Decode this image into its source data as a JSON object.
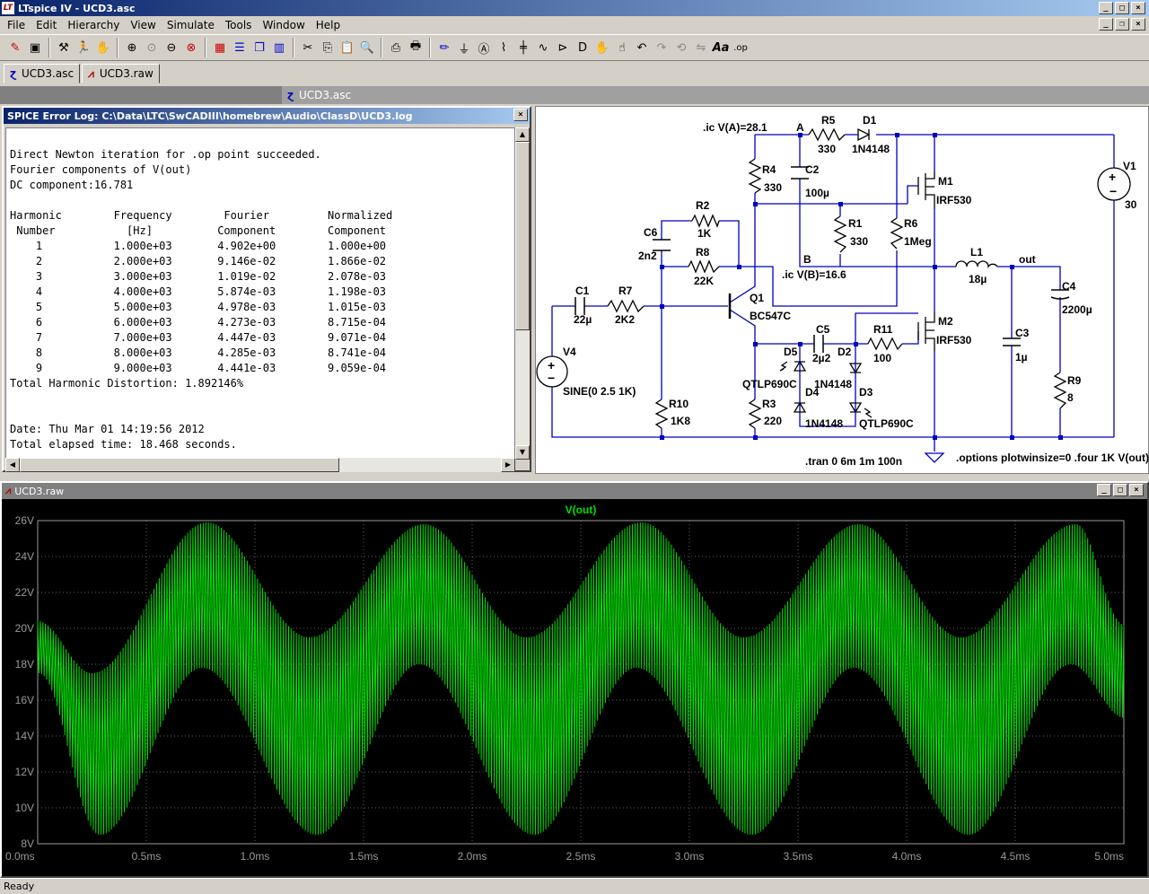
{
  "window": {
    "title": "LTspice IV - UCD3.asc",
    "controls": [
      "_",
      "□",
      "×"
    ]
  },
  "menu": [
    "File",
    "Edit",
    "Hierarchy",
    "View",
    "Simulate",
    "Tools",
    "Window",
    "Help"
  ],
  "mdi_controls": [
    "_",
    "❐",
    "×"
  ],
  "toolbar_icons": [
    "new-schematic-icon",
    "save-icon",
    "hammer-icon",
    "run-icon",
    "halt-icon",
    "zoom-in-icon",
    "zoom-pan-icon",
    "zoom-out-icon",
    "zoom-cancel-icon",
    "autorange-icon",
    "tile-horizontal-icon",
    "cascade-icon",
    "tile-vertical-icon",
    "cut-icon",
    "copy-icon",
    "paste-icon",
    "find-icon",
    "print-setup-icon",
    "print-icon",
    "draw-wire-icon",
    "ground-icon",
    "label-icon",
    "resistor-icon",
    "capacitor-icon",
    "inductor-icon",
    "diode-icon",
    "component-icon",
    "move-icon",
    "drag-icon",
    "undo-icon",
    "redo-icon",
    "rotate-icon",
    "mirror-icon",
    "text-icon",
    "spice-directive-icon"
  ],
  "tabs": [
    {
      "label": "UCD3.asc",
      "icon": "schematic-icon"
    },
    {
      "label": "UCD3.raw",
      "icon": "waveform-icon"
    }
  ],
  "mdi_active_title": "UCD3.asc",
  "error_log": {
    "title": "SPICE Error Log: C:\\Data\\LTC\\SwCADIII\\homebrew\\Audio\\ClassD\\UCD3.log",
    "close": "×",
    "text": "\nDirect Newton iteration for .op point succeeded.\nFourier components of V(out)\nDC component:16.781\n\nHarmonic        Frequency        Fourier         Normalized\n Number           [Hz]          Component        Component\n    1           1.000e+03       4.902e+00        1.000e+00\n    2           2.000e+03       9.146e-02        1.866e-02\n    3           3.000e+03       1.019e-02        2.078e-03\n    4           4.000e+03       5.874e-03        1.198e-03\n    5           5.000e+03       4.978e-03        1.015e-03\n    6           6.000e+03       4.273e-03        8.715e-04\n    7           7.000e+03       4.447e-03        9.071e-04\n    8           8.000e+03       4.285e-03        8.741e-04\n    9           9.000e+03       4.441e-03        9.059e-04\nTotal Harmonic Distortion: 1.892146%\n\n\nDate: Thu Mar 01 14:19:56 2012\nTotal elapsed time: 18.468 seconds."
  },
  "schematic": {
    "ic_a": ".ic V(A)=28.1",
    "ic_b": ".ic V(B)=16.6",
    "tran": ".tran 0 6m 1m 100n",
    "options": ".options plotwinsize=0 .four 1K V(out)",
    "node_a": "A",
    "node_b": "B",
    "node_out": "out",
    "components": {
      "R5": {
        "name": "R5",
        "value": "330"
      },
      "D1": {
        "name": "D1",
        "value": "1N4148"
      },
      "V1": {
        "name": "V1",
        "value": "30"
      },
      "R4": {
        "name": "R4",
        "value": "330"
      },
      "C2": {
        "name": "C2",
        "value": "100µ"
      },
      "M1": {
        "name": "M1",
        "value": "IRF530"
      },
      "R2": {
        "name": "R2",
        "value": "1K"
      },
      "R1": {
        "name": "R1",
        "value": "330"
      },
      "R6": {
        "name": "R6",
        "value": "1Meg"
      },
      "C6": {
        "name": "C6",
        "value": "2n2"
      },
      "R8": {
        "name": "R8",
        "value": "22K"
      },
      "L1": {
        "name": "L1",
        "value": "18µ"
      },
      "C4": {
        "name": "C4",
        "value": "2200µ"
      },
      "C1": {
        "name": "C1",
        "value": "22µ"
      },
      "R7": {
        "name": "R7",
        "value": "2K2"
      },
      "Q1": {
        "name": "Q1",
        "value": "BC547C"
      },
      "M2": {
        "name": "M2",
        "value": "IRF530"
      },
      "C5": {
        "name": "C5",
        "value": "2µ2"
      },
      "R11": {
        "name": "R11",
        "value": "100"
      },
      "D5": {
        "name": "D5",
        "value": "QTLP690C"
      },
      "D2": {
        "name": "D2",
        "value": "1N4148"
      },
      "C3": {
        "name": "C3",
        "value": "1µ"
      },
      "V4": {
        "name": "V4",
        "value": "SINE(0 2.5 1K)"
      },
      "D4": {
        "name": "D4",
        "value": "1N4148"
      },
      "D3": {
        "name": "D3",
        "value": "QTLP690C"
      },
      "R10": {
        "name": "R10",
        "value": "1K8"
      },
      "R3": {
        "name": "R3",
        "value": "220"
      },
      "R9": {
        "name": "R9",
        "value": "8"
      }
    }
  },
  "wave_window": {
    "title": "UCD3.raw",
    "controls": [
      "_",
      "□",
      "×"
    ]
  },
  "chart_data": {
    "type": "line",
    "title": "",
    "xlabel": "",
    "ylabel": "",
    "series": [
      {
        "name": "V(out)",
        "color": "#00e000",
        "envelope_center": "16.8 + 4.9·sin(2π·1kHz·t)",
        "ripple_pp_max": 10
      }
    ],
    "xlim": [
      0,
      5
    ],
    "ylim": [
      8,
      26
    ],
    "x_ticks": [
      "0.0ms",
      "0.5ms",
      "1.0ms",
      "1.5ms",
      "2.0ms",
      "2.5ms",
      "3.0ms",
      "3.5ms",
      "4.0ms",
      "4.5ms",
      "5.0ms"
    ],
    "y_ticks": [
      "8V",
      "10V",
      "12V",
      "14V",
      "16V",
      "18V",
      "20V",
      "22V",
      "24V",
      "26V"
    ],
    "envelope_upper": [
      [
        0,
        20.4
      ],
      [
        0.25,
        17.5
      ],
      [
        0.78,
        25.9
      ],
      [
        1.25,
        19.5
      ],
      [
        1.78,
        25.8
      ],
      [
        2.25,
        19.5
      ],
      [
        2.78,
        25.9
      ],
      [
        3.25,
        19.5
      ],
      [
        3.78,
        25.8
      ],
      [
        4.25,
        19.5
      ],
      [
        4.78,
        25.8
      ],
      [
        5,
        20.2
      ]
    ],
    "envelope_lower": [
      [
        0,
        17.5
      ],
      [
        0.28,
        8.5
      ],
      [
        0.75,
        17.8
      ],
      [
        1.28,
        8.5
      ],
      [
        1.75,
        18.0
      ],
      [
        2.28,
        8.5
      ],
      [
        2.75,
        17.8
      ],
      [
        3.28,
        8.5
      ],
      [
        3.75,
        17.8
      ],
      [
        4.28,
        8.5
      ],
      [
        4.75,
        18.0
      ],
      [
        5,
        15.0
      ]
    ],
    "grid": true,
    "grid_color": "#606060"
  },
  "status": "Ready"
}
